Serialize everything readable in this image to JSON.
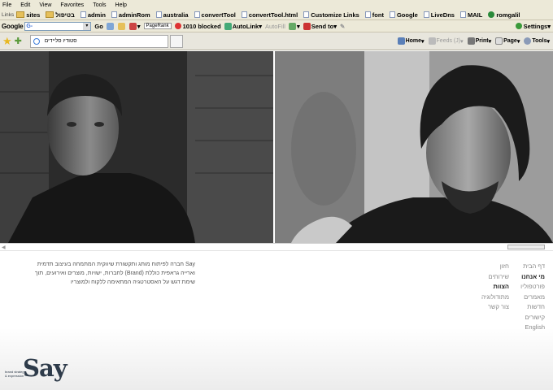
{
  "menu": [
    "File",
    "Edit",
    "View",
    "Favorites",
    "Tools",
    "Help"
  ],
  "links": {
    "label": "Links",
    "items": [
      {
        "label": "sites",
        "icon": "folder-icon"
      },
      {
        "label": "בטיפול",
        "icon": "folder-icon"
      },
      {
        "label": "admin",
        "icon": "page-icon"
      },
      {
        "label": "adminRom",
        "icon": "page-icon"
      },
      {
        "label": "australia",
        "icon": "page-icon"
      },
      {
        "label": "convertTool",
        "icon": "page-icon"
      },
      {
        "label": "convertTool.html",
        "icon": "page-icon"
      },
      {
        "label": "Customize Links",
        "icon": "page-icon"
      },
      {
        "label": "font",
        "icon": "page-icon"
      },
      {
        "label": "Google",
        "icon": "page-icon"
      },
      {
        "label": "LiveDns",
        "icon": "page-icon"
      },
      {
        "label": "MAIL",
        "icon": "page-icon"
      },
      {
        "label": "romgalil",
        "icon": "globe-icon"
      }
    ]
  },
  "google": {
    "logo": "Google",
    "search_value": "G-",
    "go": "Go",
    "pagerank": "PageRank",
    "blocked": "1010 blocked",
    "autolink": "AutoLink",
    "autofill": "AutoFill",
    "sendto": "Send to",
    "settings": "Settings"
  },
  "tab": {
    "title": "סטודיו סליידים"
  },
  "commands": {
    "home": "Home",
    "feeds": "Feeds (J)",
    "print": "Print",
    "page": "Page",
    "tools": "Tools"
  },
  "about_text": "Say חברה לפיתוח מותג ותקשורת שיווקית המתמחה בעיצוב תדמית וארייה גראפית כוללת (Brand) לחברות, ישויות, מוצרים ואירועים, תוך שימת דגש על האסטרטגיה המתאימה ללקוח ולמוצריו",
  "nav_primary": [
    {
      "label": "דף הבית",
      "active": false
    },
    {
      "label": "מי אנחנו",
      "active": true
    },
    {
      "label": "פורטפוליו",
      "active": false
    },
    {
      "label": "מאמרים",
      "active": false
    },
    {
      "label": "חדשות",
      "active": false
    },
    {
      "label": "קישורים",
      "active": false
    },
    {
      "label": "English",
      "active": false
    }
  ],
  "nav_secondary": [
    {
      "label": "חזון",
      "active": false
    },
    {
      "label": "שירותים",
      "active": false
    },
    {
      "label": "הצוות",
      "active": true
    },
    {
      "label": "מתודולוגיה",
      "active": false
    },
    {
      "label": "צור קשר",
      "active": false
    }
  ],
  "logo": {
    "name": "Say",
    "tagline1": "brand strategy",
    "tagline2": "& expression"
  },
  "colors": {
    "logo": "#2e3b4a",
    "chrome": "#ece9d8",
    "nav": "#888888",
    "nav_active": "#222222"
  }
}
